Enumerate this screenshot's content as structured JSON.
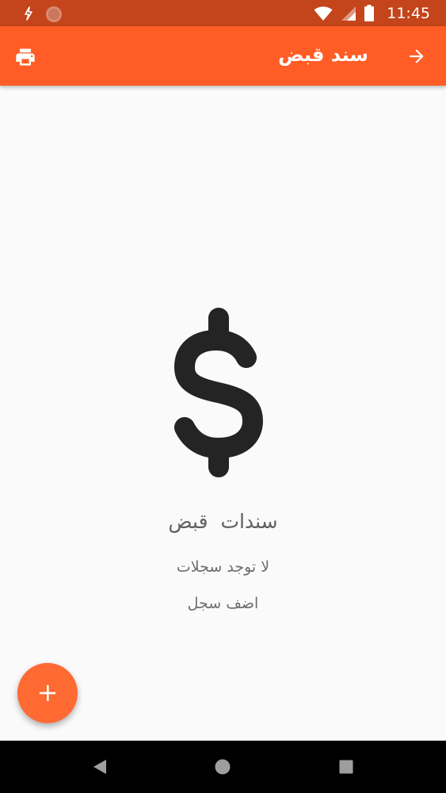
{
  "status_bar": {
    "time": "11:45",
    "icons": [
      "notification-icon",
      "app-notification-icon",
      "wifi-icon",
      "signal-icon",
      "battery-icon"
    ]
  },
  "app_bar": {
    "title": "سند قبض",
    "icons": [
      "arrow-forward-icon",
      "print-icon"
    ]
  },
  "empty_state": {
    "icon": "dollar-icon",
    "title": "سندات قبض",
    "subtitle": "لا توجد سجلات",
    "action": "اضف سجل"
  },
  "fab": {
    "icon": "plus-icon"
  },
  "nav_bar": {
    "icons": [
      "back-triangle-icon",
      "home-circle-icon",
      "recents-square-icon"
    ]
  },
  "colors": {
    "status_bar": "#c4441b",
    "app_bar": "#ff5d25",
    "fab": "#ff6a33",
    "background": "#fafafa"
  }
}
